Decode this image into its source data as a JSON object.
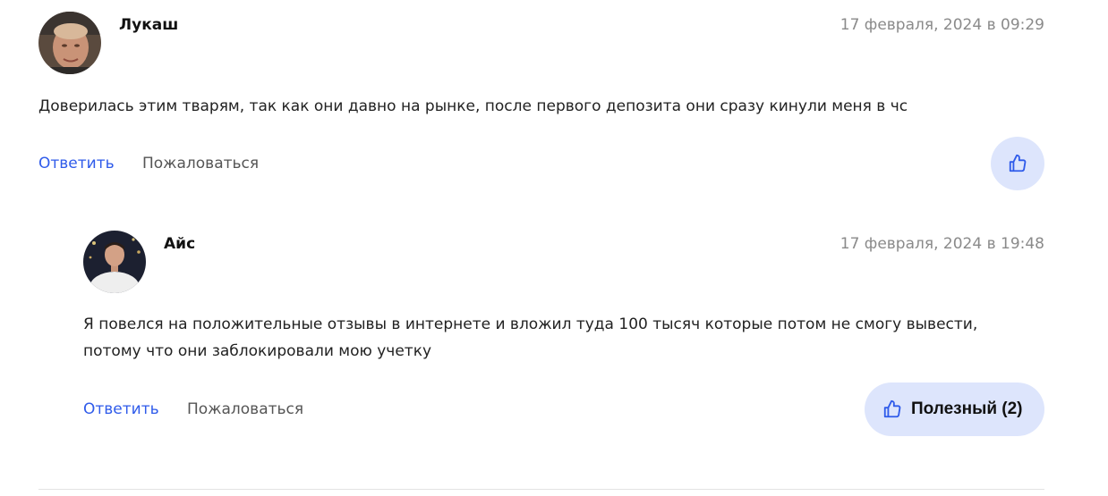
{
  "colors": {
    "link": "#2f5bea",
    "like_bg": "#dde5fc",
    "date": "#8a8a8a"
  },
  "comments": [
    {
      "author": "Лукаш",
      "date": "17 февраля, 2024 в 09:29",
      "text": "Доверилась этим тварям, так как они давно на рынке, после первого депозита они сразу кинули меня в чс",
      "reply_label": "Ответить",
      "report_label": "Пожаловаться",
      "like_icon": "thumbs-up-icon"
    },
    {
      "author": "Айс",
      "date": "17 февраля, 2024 в 19:48",
      "text_line1": "Я повелся на положительные отзывы в интернете и вложил туда 100 тысяч которые потом не смогу вывести,",
      "text_line2": "потому что они заблокировали мою учетку",
      "reply_label": "Ответить",
      "report_label": "Пожаловаться",
      "like_label": "Полезный (2)",
      "like_icon": "thumbs-up-icon"
    }
  ]
}
